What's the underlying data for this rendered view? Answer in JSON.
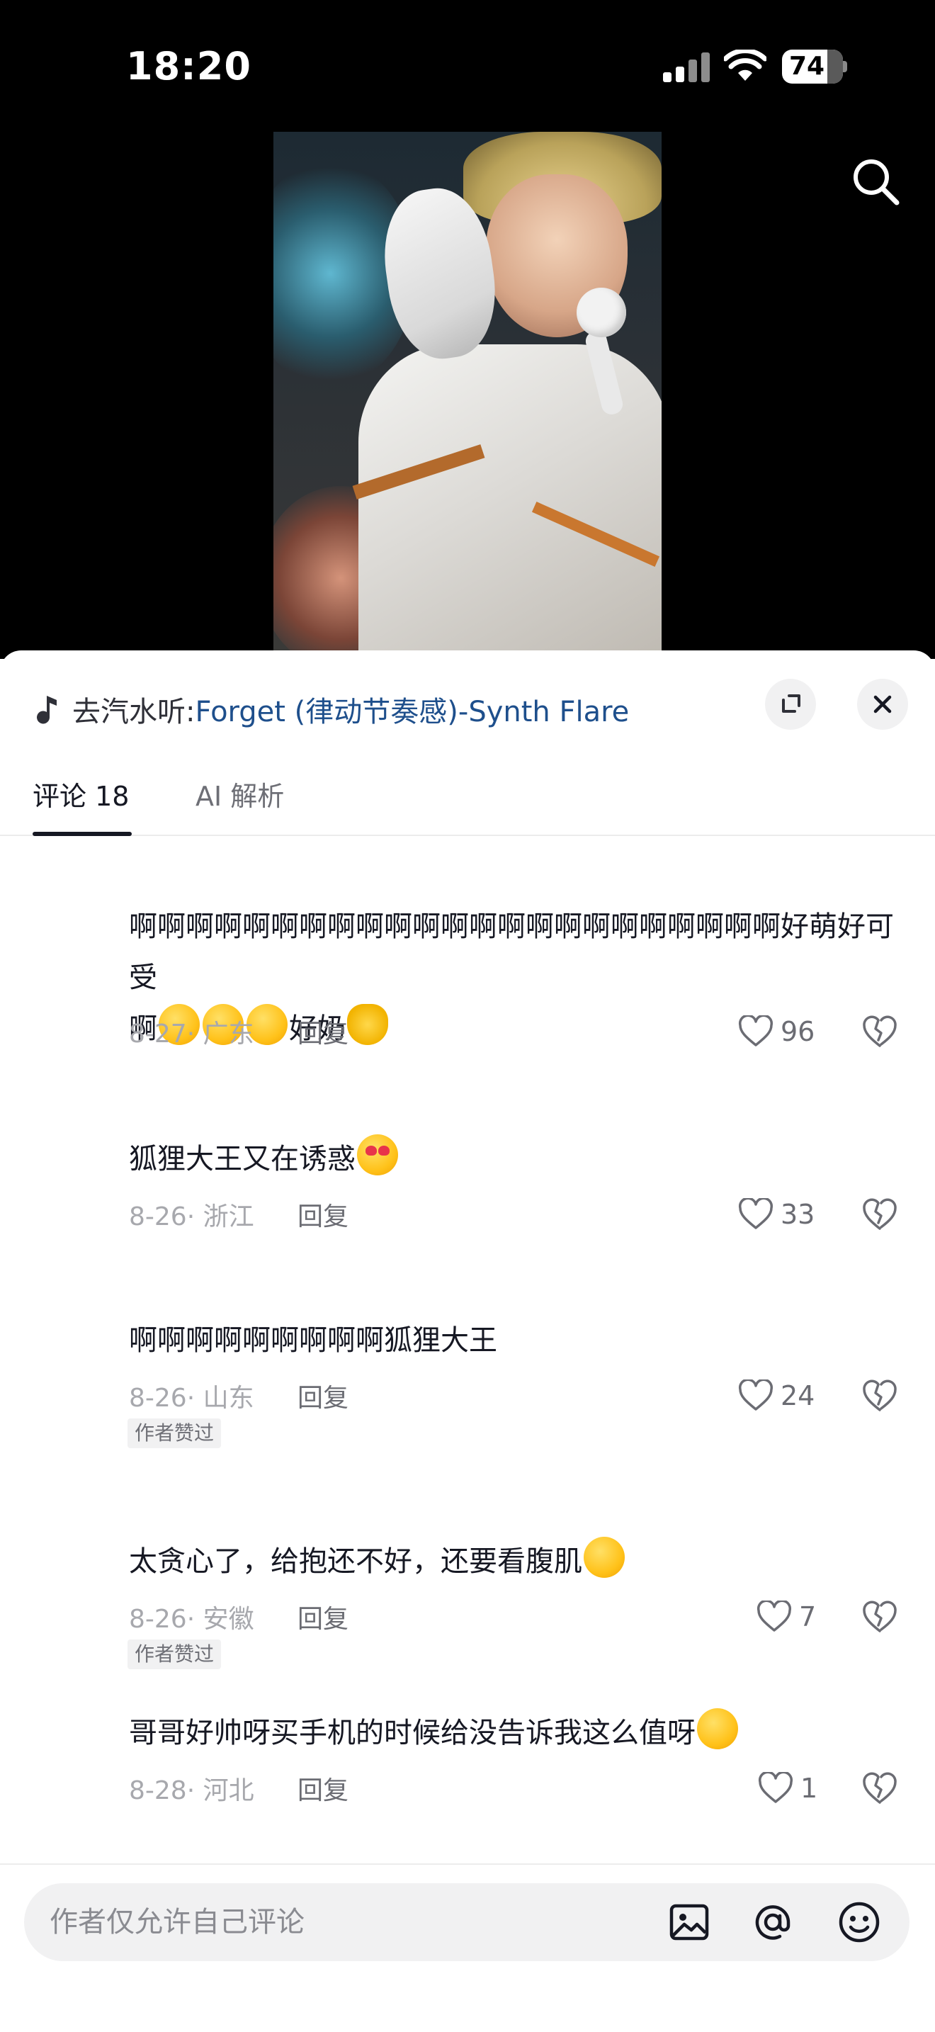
{
  "status_bar": {
    "time": "18:20",
    "battery": "74"
  },
  "music": {
    "prefix": "去汽水听:",
    "title": "Forget (律动节奏感)-Synth Flare"
  },
  "tabs": [
    {
      "label": "评论 18"
    },
    {
      "label": "AI 解析"
    }
  ],
  "comments": [
    {
      "text": "啊啊啊啊啊啊啊啊啊啊啊啊啊啊啊啊啊啊啊啊啊啊啊好萌好可受",
      "text2": "啊",
      "text3": "好奶",
      "date": "8-27",
      "location": "· 广东",
      "reply": "回复",
      "likes": "96"
    },
    {
      "text": "狐狸大王又在诱惑",
      "date": "8-26",
      "location": "· 浙江",
      "reply": "回复",
      "likes": "33"
    },
    {
      "text": "啊啊啊啊啊啊啊啊啊狐狸大王",
      "date": "8-26",
      "location": "· 山东",
      "reply": "回复",
      "likes": "24",
      "badge": "作者赞过"
    },
    {
      "text": "太贪心了，给抱还不好，还要看腹肌",
      "date": "8-26",
      "location": "· 安徽",
      "reply": "回复",
      "likes": "7",
      "badge": "作者赞过"
    },
    {
      "text": "哥哥好帅呀买手机的时候给没告诉我这么值呀",
      "date": "8-28",
      "location": "· 河北",
      "reply": "回复",
      "likes": "1"
    }
  ],
  "input": {
    "placeholder": "作者仅允许自己评论"
  },
  "icons": {
    "music": "music-note-icon",
    "expand": "expand-icon",
    "close": "close-icon",
    "search": "search-icon",
    "like": "heart-outline-icon",
    "dislike": "broken-heart-icon",
    "image": "image-icon",
    "mention": "at-icon",
    "emoji": "smiley-icon"
  }
}
